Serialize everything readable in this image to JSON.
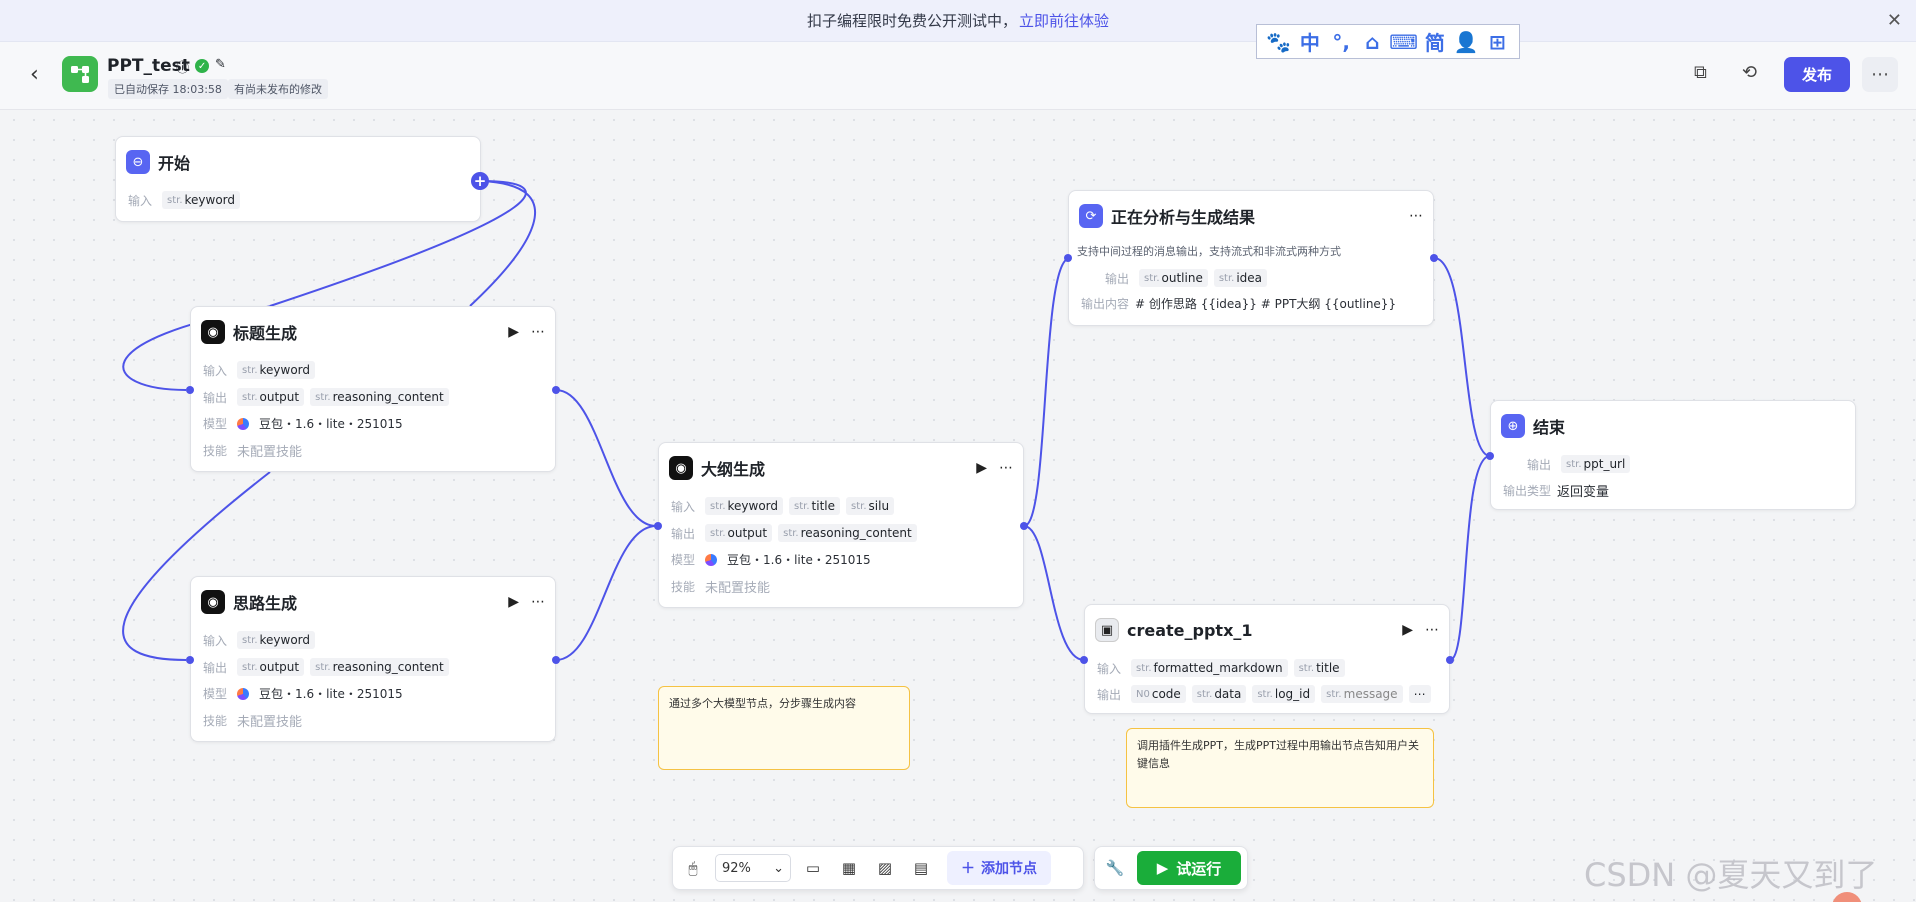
{
  "banner": {
    "text": "扣子编程限时免费公开测试中，",
    "link": "立即前往体验"
  },
  "ime": [
    "🐾",
    "中",
    "°,",
    "⌂",
    "⌨",
    "简",
    "👤",
    "⊞"
  ],
  "header": {
    "title": "PPT_test",
    "autosave": "已自动保存 18:03:58",
    "unpublished": "有尚未发布的修改",
    "publish": "发布"
  },
  "nodes": {
    "start": {
      "title": "开始",
      "input_label": "输入",
      "input": "keyword"
    },
    "title_gen": {
      "title": "标题生成",
      "in_label": "输入",
      "out_label": "输出",
      "model_label": "模型",
      "skill_label": "技能",
      "input": "keyword",
      "out1": "output",
      "out2": "reasoning_content",
      "model": "豆包・1.6・lite・251015",
      "skill": "未配置技能"
    },
    "idea_gen": {
      "title": "思路生成",
      "in_label": "输入",
      "out_label": "输出",
      "model_label": "模型",
      "skill_label": "技能",
      "input": "keyword",
      "out1": "output",
      "out2": "reasoning_content",
      "model": "豆包・1.6・lite・251015",
      "skill": "未配置技能"
    },
    "outline_gen": {
      "title": "大纲生成",
      "in_label": "输入",
      "out_label": "输出",
      "model_label": "模型",
      "skill_label": "技能",
      "in1": "keyword",
      "in2": "title",
      "in3": "silu",
      "out1": "output",
      "out2": "reasoning_content",
      "model": "豆包・1.6・lite・251015",
      "skill": "未配置技能"
    },
    "analysis": {
      "title": "正在分析与生成结果",
      "desc": "支持中间过程的消息输出，支持流式和非流式两种方式",
      "out_label": "输出",
      "out1": "outline",
      "out2": "idea",
      "content_label": "输出内容",
      "content": "# 创作思路 {{idea}} # PPT大纲 {{outline}}"
    },
    "end": {
      "title": "结束",
      "out_label": "输出",
      "out1": "ppt_url",
      "type_label": "输出类型",
      "type": "返回变量"
    },
    "pptx": {
      "title": "create_pptx_1",
      "in_label": "输入",
      "out_label": "输出",
      "in1": "formatted_markdown",
      "in2": "title",
      "out1": "code",
      "out2": "data",
      "out3": "log_id",
      "out4": "message"
    }
  },
  "type_tags": {
    "str": "str.",
    "num": "N0"
  },
  "notes": {
    "note1": "通过多个大模型节点，分步骤生成内容",
    "note2": "调用插件生成PPT，生成PPT过程中用输出节点告知用户关键信息"
  },
  "toolbar": {
    "zoom": "92%",
    "add_node": "添加节点",
    "test_run": "试运行"
  },
  "watermark": "CSDN @夏天又到了",
  "colors": {
    "accent": "#4d53e8",
    "run": "#1aad3a",
    "app_icon": "#3fb950"
  }
}
